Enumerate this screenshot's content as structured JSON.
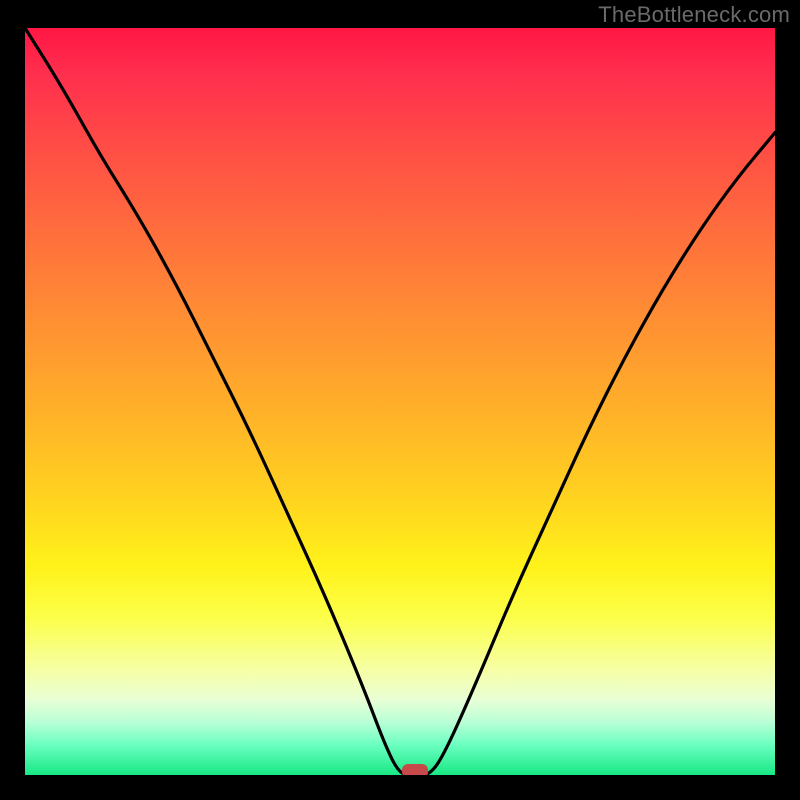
{
  "watermark": "TheBottleneck.com",
  "colors": {
    "top": "#ff1744",
    "mid": "#ffd020",
    "bottom": "#17e884",
    "curve": "#000000",
    "marker": "#c74a4a",
    "frame": "#000000"
  },
  "chart_data": {
    "type": "line",
    "title": "",
    "xlabel": "",
    "ylabel": "",
    "xlim": [
      0,
      100
    ],
    "ylim": [
      0,
      100
    ],
    "grid": false,
    "legend": false,
    "series": [
      {
        "name": "bottleneck-curve",
        "x": [
          0,
          5,
          10,
          15,
          20,
          25,
          30,
          35,
          40,
          45,
          48,
          50,
          52,
          54,
          56,
          60,
          65,
          70,
          75,
          80,
          85,
          90,
          95,
          100
        ],
        "y": [
          100,
          92,
          83,
          75,
          66,
          56,
          46,
          35,
          24,
          12,
          4,
          0,
          0,
          0,
          3,
          12,
          24,
          35,
          46,
          56,
          65,
          73,
          80,
          86
        ]
      }
    ],
    "annotations": [
      {
        "name": "optimum-marker",
        "x": 52,
        "y": 0,
        "shape": "rounded-rect",
        "color": "#c74a4a"
      }
    ],
    "background_gradient": {
      "direction": "vertical",
      "stops": [
        {
          "pos": 0.0,
          "color": "#ff1744"
        },
        {
          "pos": 0.5,
          "color": "#ffad2a"
        },
        {
          "pos": 0.78,
          "color": "#fcff4a"
        },
        {
          "pos": 1.0,
          "color": "#17e884"
        }
      ]
    }
  }
}
